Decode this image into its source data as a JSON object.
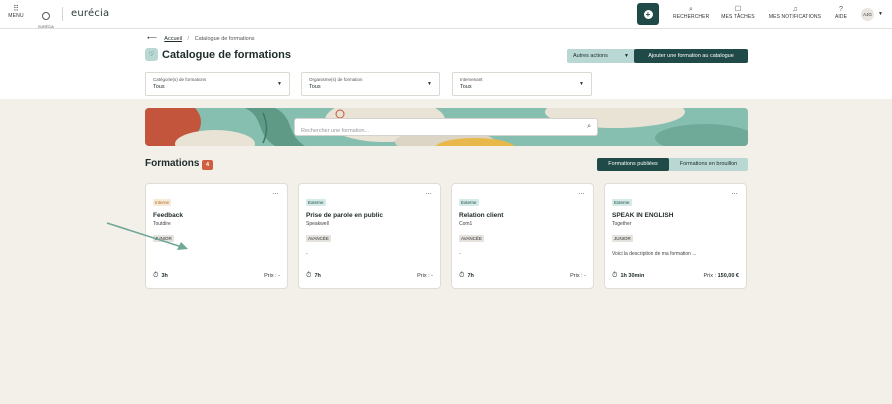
{
  "topbar": {
    "menu_label": "MENU",
    "logo_small_text": "EURÉCIA",
    "brand": "eurécia",
    "nav": [
      {
        "icon": "search-icon",
        "label": "RECHERCHER"
      },
      {
        "icon": "tasks-icon",
        "label": "MES TÂCHES"
      },
      {
        "icon": "bell-icon",
        "label": "MES NOTIFICATIONS"
      },
      {
        "icon": "help-icon",
        "label": "AIDE"
      }
    ],
    "avatar_initials": "AJG"
  },
  "breadcrumb": {
    "home": "Accueil",
    "current": "Catalogue de formations"
  },
  "page": {
    "title": "Catalogue de formations",
    "autres_actions": "Autres actions",
    "add_button": "Ajouter une formation au catalogue"
  },
  "filters": [
    {
      "label": "Catégorie(s) de formations",
      "value": "Tous"
    },
    {
      "label": "Organisme(s) de formation",
      "value": "Tous"
    },
    {
      "label": "Intervenant",
      "value": "Tous"
    }
  ],
  "search": {
    "placeholder": "Rechercher une formation..."
  },
  "section": {
    "title": "Formations",
    "count": "4",
    "toggle_active": "Formations publiées",
    "toggle_inactive": "Formations en brouillon"
  },
  "cards": [
    {
      "type": "Interne",
      "name": "Feedback",
      "org": "Toutdire",
      "level": "JUNIOR",
      "desc": "",
      "duration": "3h",
      "price_label": "Prix :",
      "price": "-"
    },
    {
      "type": "Externe",
      "name": "Prise de parole en public",
      "org": "Speakwell",
      "level": "AVANCÉE",
      "desc": "-",
      "duration": "7h",
      "price_label": "Prix :",
      "price": "-"
    },
    {
      "type": "Externe",
      "name": "Relation client",
      "org": "Com1",
      "level": "AVANCÉE",
      "desc": "-",
      "duration": "7h",
      "price_label": "Prix :",
      "price": "-"
    },
    {
      "type": "Externe",
      "name": "SPEAK IN ENGLISH",
      "org": "Together",
      "level": "JUNIOR",
      "desc": "Voici la description de ma formation ...",
      "duration": "1h 30min",
      "price_label": "Prix :",
      "price": "150,00 €"
    }
  ],
  "colors": {
    "primary": "#1f4a47",
    "accent_light": "#b9d8d4",
    "badge": "#cf5f3f",
    "background": "#f3efe9"
  }
}
